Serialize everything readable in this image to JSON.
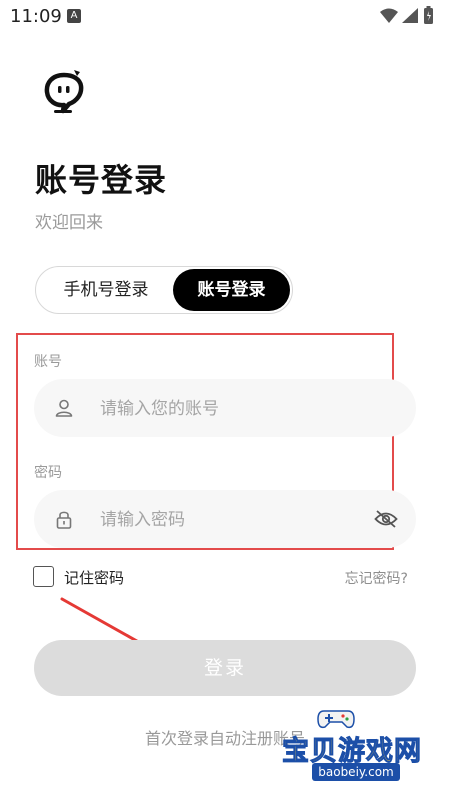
{
  "status": {
    "time": "11:09",
    "notice_glyph": "A"
  },
  "header": {
    "title": "账号登录",
    "subtitle": "欢迎回来"
  },
  "tabs": [
    {
      "label": "手机号登录",
      "active": false
    },
    {
      "label": "账号登录",
      "active": true
    }
  ],
  "form": {
    "account_label": "账号",
    "account_placeholder": "请输入您的账号",
    "password_label": "密码",
    "password_placeholder": "请输入密码"
  },
  "options": {
    "remember_label": "记住密码",
    "forgot_label": "忘记密码?"
  },
  "actions": {
    "login_label": "登录"
  },
  "footer": {
    "note": "首次登录自动注册账号"
  },
  "watermark": {
    "title": "宝贝游戏网",
    "url": "baobeiy.com"
  },
  "colors": {
    "highlight_box": "#e34b4b",
    "login_disabled": "#dcdcdc",
    "active_tab": "#000000"
  },
  "icons": [
    "wifi-icon",
    "signal-icon",
    "battery-icon",
    "user-icon",
    "lock-icon",
    "eye-off-icon"
  ]
}
